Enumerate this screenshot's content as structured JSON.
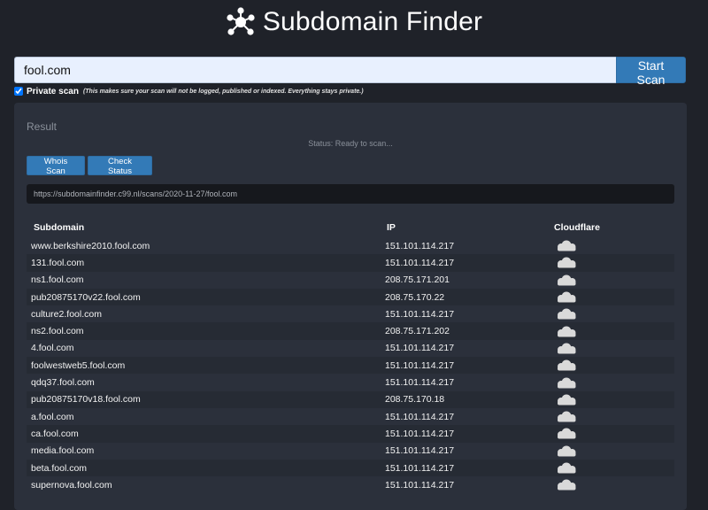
{
  "app": {
    "title": "Subdomain Finder",
    "logo_icon": "hub-network-icon"
  },
  "search": {
    "value": "fool.com",
    "start_label": "Start Scan"
  },
  "private_scan": {
    "checked": true,
    "label": "Private scan",
    "note": "(This makes sure your scan will not be logged, published or indexed. Everything stays private.)"
  },
  "result": {
    "title": "Result",
    "status": "Status: Ready to scan...",
    "whois_label": "Whois Scan",
    "check_label": "Check Status",
    "url": "https://subdomainfinder.c99.nl/scans/2020-11-27/fool.com"
  },
  "table": {
    "headers": {
      "subdomain": "Subdomain",
      "ip": "IP",
      "cloudflare": "Cloudflare"
    },
    "rows": [
      {
        "subdomain": "www.berkshire2010.fool.com",
        "ip": "151.101.114.217",
        "cloudflare": "cloud-off-icon"
      },
      {
        "subdomain": "131.fool.com",
        "ip": "151.101.114.217",
        "cloudflare": "cloud-off-icon"
      },
      {
        "subdomain": "ns1.fool.com",
        "ip": "208.75.171.201",
        "cloudflare": "cloud-off-icon"
      },
      {
        "subdomain": "pub20875170v22.fool.com",
        "ip": "208.75.170.22",
        "cloudflare": "cloud-off-icon"
      },
      {
        "subdomain": "culture2.fool.com",
        "ip": "151.101.114.217",
        "cloudflare": "cloud-off-icon"
      },
      {
        "subdomain": "ns2.fool.com",
        "ip": "208.75.171.202",
        "cloudflare": "cloud-off-icon"
      },
      {
        "subdomain": "4.fool.com",
        "ip": "151.101.114.217",
        "cloudflare": "cloud-off-icon"
      },
      {
        "subdomain": "foolwestweb5.fool.com",
        "ip": "151.101.114.217",
        "cloudflare": "cloud-off-icon"
      },
      {
        "subdomain": "qdq37.fool.com",
        "ip": "151.101.114.217",
        "cloudflare": "cloud-off-icon"
      },
      {
        "subdomain": "pub20875170v18.fool.com",
        "ip": "208.75.170.18",
        "cloudflare": "cloud-off-icon"
      },
      {
        "subdomain": "a.fool.com",
        "ip": "151.101.114.217",
        "cloudflare": "cloud-off-icon"
      },
      {
        "subdomain": "ca.fool.com",
        "ip": "151.101.114.217",
        "cloudflare": "cloud-off-icon"
      },
      {
        "subdomain": "media.fool.com",
        "ip": "151.101.114.217",
        "cloudflare": "cloud-off-icon"
      },
      {
        "subdomain": "beta.fool.com",
        "ip": "151.101.114.217",
        "cloudflare": "cloud-off-icon"
      },
      {
        "subdomain": "supernova.fool.com",
        "ip": "151.101.114.217",
        "cloudflare": "cloud-off-icon"
      }
    ]
  },
  "colors": {
    "background": "#1f2229",
    "panel": "#2b303b",
    "accent": "#337ab7",
    "cloud": "#d9d9d9"
  }
}
